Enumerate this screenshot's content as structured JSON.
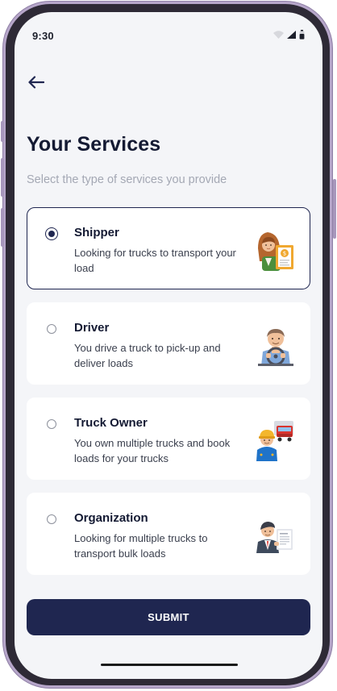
{
  "status_bar": {
    "time": "9:30",
    "icons": [
      "wifi-icon",
      "signal-icon",
      "battery-icon"
    ]
  },
  "header": {
    "back_icon": "arrow-left-icon",
    "title": "Your Services",
    "subtitle": "Select the type of services you provide"
  },
  "services": {
    "selected": "Shipper",
    "items": [
      {
        "title": "Shipper",
        "description": "Looking for trucks to transport your load",
        "icon": "shipper-woman-illustration",
        "selected": true
      },
      {
        "title": "Driver",
        "description": "You drive a truck to pick-up and deliver loads",
        "icon": "driver-illustration",
        "selected": false
      },
      {
        "title": "Truck Owner",
        "description": "You own multiple trucks and book loads for your trucks",
        "icon": "truck-owner-illustration",
        "selected": false
      },
      {
        "title": "Organization",
        "description": "Looking for multiple trucks to transport bulk loads",
        "icon": "organization-businessman-illustration",
        "selected": false
      }
    ]
  },
  "submit": {
    "label": "SUBMIT"
  },
  "colors": {
    "primary": "#1f2650",
    "background": "#f4f5f8",
    "card": "#ffffff",
    "title_text": "#141a33",
    "subtitle_text": "#a4a8b4",
    "frame": "#b6a6c9"
  }
}
